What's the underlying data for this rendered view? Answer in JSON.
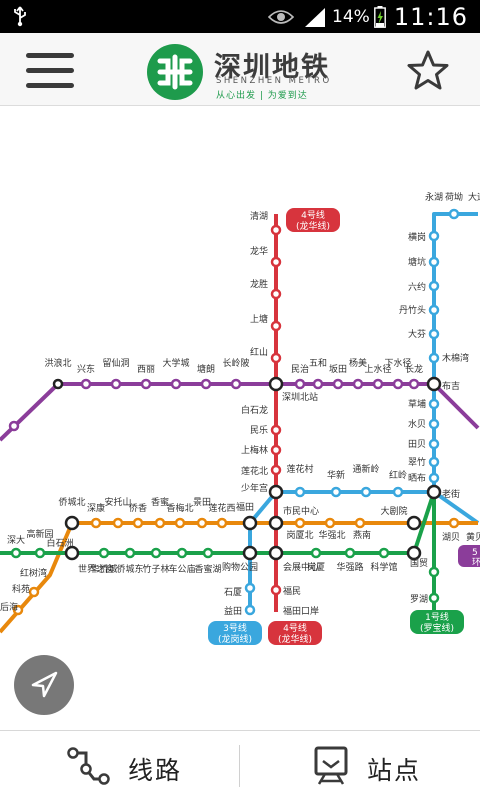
{
  "status_bar": {
    "battery": "14%",
    "time": "11:16"
  },
  "header": {
    "logo_title": "深圳地铁",
    "logo_subtitle": "SHENZHEN METRO",
    "logo_slogan": "从心出发 | 为爱到达"
  },
  "map": {
    "colors": {
      "line1": "#1aa14a",
      "line2": "#e8880c",
      "line3": "#3aa7de",
      "line4": "#d7343d",
      "line5": "#8b3d9a"
    },
    "badges": {
      "line4_top_1": "4号线",
      "line4_top_2": "(龙华线)",
      "line3_1": "3号线",
      "line3_2": "(龙岗线)",
      "line4_bottom_1": "4号线",
      "line4_bottom_2": "(龙华线)",
      "line1_1": "1号线",
      "line1_2": "(罗宝线)",
      "line5_1": "5",
      "line5_2": "环"
    },
    "stations": {
      "l4": [
        "清湖",
        "龙华",
        "龙胜",
        "上塘",
        "红山",
        "深圳北站",
        "白石龙",
        "民乐",
        "上梅林",
        "莲花北",
        "少年宫",
        "市民中心",
        "会展中心",
        "福民",
        "福田口岸"
      ],
      "l5": [
        "洪浪北",
        "兴东",
        "留仙洞",
        "西丽",
        "大学城",
        "塘朗",
        "长岭陂",
        "民治",
        "五和",
        "坂田",
        "杨美",
        "上水径",
        "下水径",
        "长龙",
        "布吉"
      ],
      "l3": [
        "横岗",
        "塘坑",
        "六约",
        "丹竹头",
        "大芬",
        "木棉湾",
        "草埔",
        "水贝",
        "田贝",
        "翠竹",
        "晒布",
        "老街",
        "莲花村",
        "华新",
        "通新岭",
        "红岭",
        "湖贝",
        "黄贝",
        "国贸",
        "罗湖",
        "福田",
        "购物公园",
        "石厦",
        "益田"
      ],
      "l2": [
        "侨城北",
        "深康",
        "安托山",
        "侨香",
        "香蜜",
        "香梅北",
        "景田",
        "莲花西",
        "岗厦北",
        "华强北",
        "燕南",
        "大剧院"
      ],
      "l1": [
        "深大",
        "高新园",
        "白石洲",
        "世界之窗",
        "华侨城",
        "侨城东",
        "竹子林",
        "车公庙",
        "香蜜湖",
        "岗厦",
        "华强路",
        "科学馆"
      ],
      "edge": [
        "永湖",
        "荷坳",
        "大运",
        "红树湾",
        "科苑",
        "后海"
      ]
    }
  },
  "tabs": {
    "routes": "线路",
    "stations": "站点"
  }
}
